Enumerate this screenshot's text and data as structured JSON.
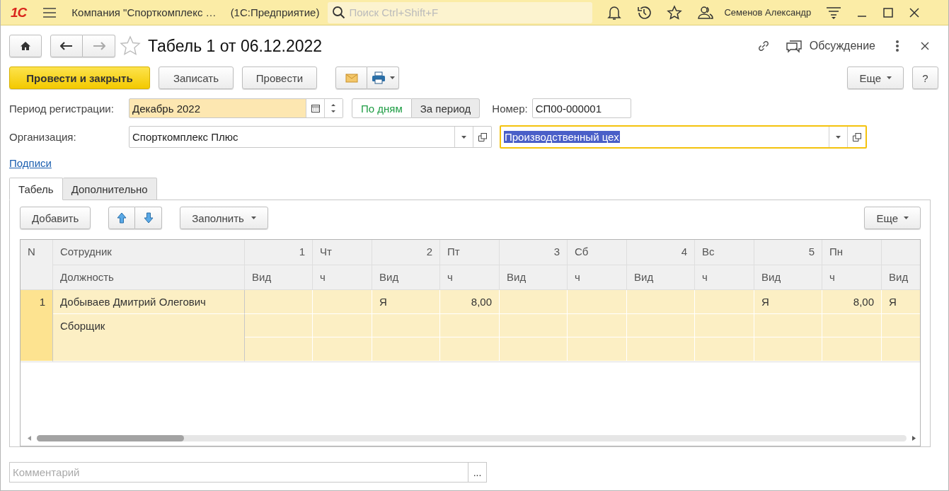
{
  "app_bar": {
    "logo": "1С",
    "title": "Компания \"Спорткомплекс …",
    "app_name": "(1С:Предприятие)",
    "search": {
      "placeholder": "Поиск Ctrl+Shift+F"
    },
    "user": "Семенов Александр"
  },
  "form": {
    "title": "Табель 1 от 06.12.2022",
    "forward_disabled": true,
    "discussion": "Обсуждение"
  },
  "commands": [
    {
      "label": "Провести и закрыть",
      "kind": "default"
    },
    {
      "label": "Записать",
      "kind": "plain"
    },
    {
      "label": "Провести",
      "kind": "plain"
    }
  ],
  "more_button": "Еще",
  "help_button": "?",
  "period": {
    "label": "Период регистрации:",
    "value": "Декабрь 2022"
  },
  "period_modes": [
    {
      "label": "По дням",
      "selected": true
    },
    {
      "label": "За период",
      "selected": false
    }
  ],
  "number": {
    "label": "Номер:",
    "value": "СП00-000001"
  },
  "organization": {
    "label": "Организация:",
    "value": "Спорткомплекс Плюс"
  },
  "department": {
    "value": "Производственный цех",
    "focused": true,
    "text_selected": true
  },
  "signatures_link": "Подписи",
  "tabs": [
    {
      "label": "Табель",
      "selected": true
    },
    {
      "label": "Дополнительно",
      "selected": false
    }
  ],
  "table_toolbar": {
    "add": "Добавить",
    "fill": "Заполнить",
    "more": "Еще"
  },
  "table": {
    "columns": {
      "n": "N",
      "employee": "Сотрудник",
      "position": "Должность",
      "partial_column": "Вид"
    },
    "days": [
      {
        "num": "1",
        "weekday": "Чт",
        "type_label": "Вид",
        "hours_label": "ч"
      },
      {
        "num": "2",
        "weekday": "Пт",
        "type_label": "Вид",
        "hours_label": "ч"
      },
      {
        "num": "3",
        "weekday": "Сб",
        "type_label": "Вид",
        "hours_label": "ч"
      },
      {
        "num": "4",
        "weekday": "Вс",
        "type_label": "Вид",
        "hours_label": "ч"
      },
      {
        "num": "5",
        "weekday": "Пн",
        "type_label": "Вид",
        "hours_label": "ч"
      }
    ],
    "rows": [
      {
        "n": "1",
        "employee": "Добываев Дмитрий Олегович",
        "position": "Сборщик",
        "selected": true,
        "cells": [
          {},
          {
            "type": "Я",
            "hours": "8,00"
          },
          {},
          {},
          {
            "type": "Я",
            "hours": "8,00"
          }
        ],
        "partial_type": "Я"
      }
    ]
  },
  "comment": {
    "placeholder": "Комментарий",
    "button": "..."
  }
}
